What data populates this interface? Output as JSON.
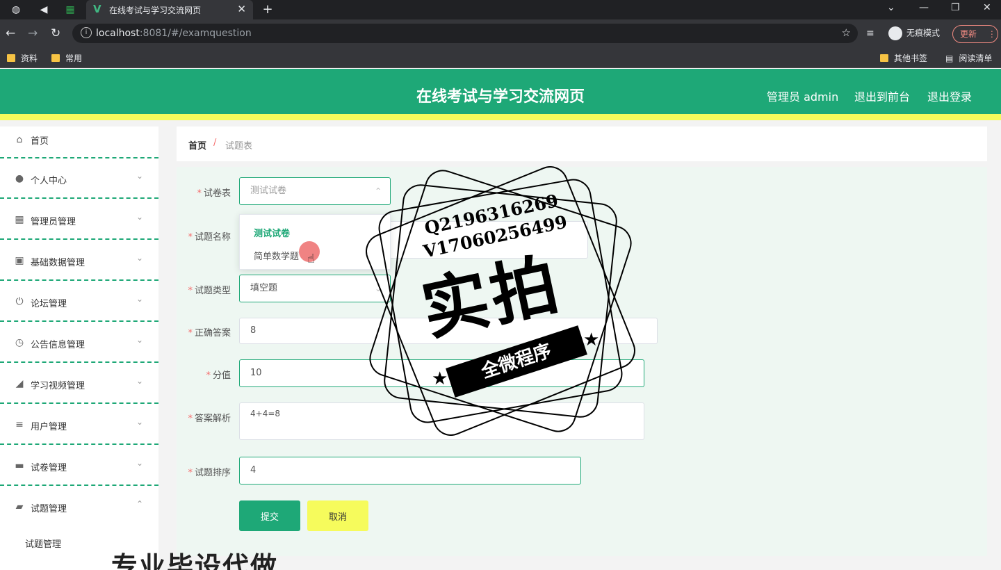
{
  "browser": {
    "tab_title": "在线考试与学习交流网页",
    "url_host": "localhost",
    "url_rest": ":8081/#/examquestion",
    "incognito_label": "无痕模式",
    "update_label": "更新",
    "bookmarks": [
      "资料",
      "常用"
    ],
    "bookmarks_right": [
      "其他书签",
      "阅读清单"
    ]
  },
  "header": {
    "title": "在线考试与学习交流网页",
    "user": "管理员 admin",
    "to_front": "退出到前台",
    "logout": "退出登录"
  },
  "sidebar": {
    "items": [
      {
        "label": "首页",
        "icon": "home-icon"
      },
      {
        "label": "个人中心",
        "icon": "user-icon"
      },
      {
        "label": "管理员管理",
        "icon": "grid-icon"
      },
      {
        "label": "基础数据管理",
        "icon": "clipboard-icon"
      },
      {
        "label": "论坛管理",
        "icon": "power-icon"
      },
      {
        "label": "公告信息管理",
        "icon": "clock-icon"
      },
      {
        "label": "学习视频管理",
        "icon": "chart-icon"
      },
      {
        "label": "用户管理",
        "icon": "list-icon"
      },
      {
        "label": "试卷管理",
        "icon": "chat-icon"
      },
      {
        "label": "试题管理",
        "icon": "briefcase-icon"
      }
    ],
    "sub_item": "试题管理"
  },
  "breadcrumb": {
    "home": "首页",
    "sep": "/",
    "current": "试题表"
  },
  "form": {
    "exam_label": "试卷表",
    "exam_value": "测试试卷",
    "name_label": "试题名称",
    "type_label": "试题类型",
    "type_value": "填空题",
    "answer_label": "正确答案",
    "answer_value": "8",
    "score_label": "分值",
    "score_value": "10",
    "analysis_label": "答案解析",
    "analysis_value": "4+4=8",
    "order_label": "试题排序",
    "order_value": "4",
    "submit": "提交",
    "cancel": "取消"
  },
  "dropdown": {
    "options": [
      "测试试卷",
      "简单数学题"
    ],
    "selected_index": 0
  },
  "watermark": {
    "line1": "Q2196316269",
    "line2": "V17060256499",
    "big": "实拍",
    "band": "全微程序",
    "banner": "专业毕设代做"
  }
}
